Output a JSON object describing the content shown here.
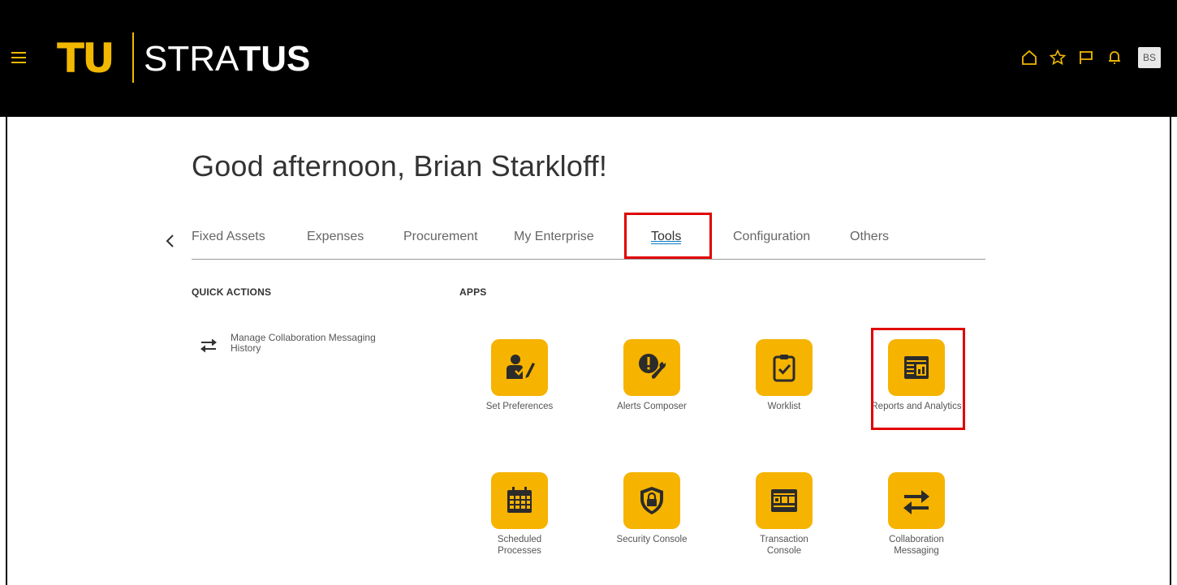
{
  "header": {
    "logo_mark": "TU",
    "logo_text_light": "STRA",
    "logo_text_bold": "TUS",
    "avatar_initials": "BS",
    "icons": [
      "home-icon",
      "star-icon",
      "flag-icon",
      "bell-icon"
    ],
    "brand_color": "#f2b800"
  },
  "main": {
    "greeting": "Good afternoon, Brian Starkloff!",
    "tabs": [
      {
        "label": "Fixed Assets"
      },
      {
        "label": "Expenses"
      },
      {
        "label": "Procurement"
      },
      {
        "label": "My Enterprise"
      },
      {
        "label": "Tools",
        "selected": true
      },
      {
        "label": "Configuration"
      },
      {
        "label": "Others"
      }
    ],
    "quick_actions": {
      "title": "QUICK ACTIONS",
      "items": [
        {
          "label": "Manage Collaboration Messaging History",
          "icon": "transfer-arrows-icon"
        }
      ]
    },
    "apps": {
      "title": "APPS",
      "items": [
        {
          "label": "Set Preferences",
          "icon": "set-preferences-icon"
        },
        {
          "label": "Alerts Composer",
          "icon": "alerts-composer-icon"
        },
        {
          "label": "Worklist",
          "icon": "worklist-icon"
        },
        {
          "label": "Reports and Analytics",
          "icon": "reports-analytics-icon"
        },
        {
          "label": "Scheduled Processes",
          "icon": "calendar-icon"
        },
        {
          "label": "Security Console",
          "icon": "shield-lock-icon"
        },
        {
          "label": "Transaction Console",
          "icon": "transaction-console-icon"
        },
        {
          "label": "Collaboration Messaging",
          "icon": "transfer-arrows-icon"
        }
      ]
    },
    "tile_color": "#f6b300",
    "highlight_color": "#e00000"
  }
}
